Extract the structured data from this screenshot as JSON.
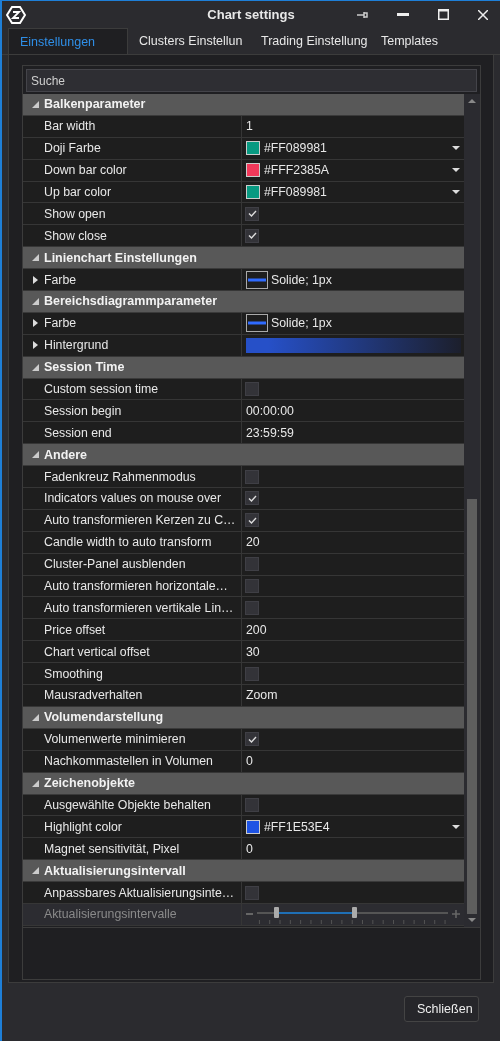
{
  "window": {
    "title": "Chart settings"
  },
  "tabs": [
    {
      "label": "Einstellungen",
      "selected": true
    },
    {
      "label": "Clusters Einstellun",
      "selected": false
    },
    {
      "label": "Trading Einstellung",
      "selected": false
    },
    {
      "label": "Templates",
      "selected": false
    }
  ],
  "search": {
    "placeholder": "Suche"
  },
  "sections": [
    {
      "title": "Balkenparameter",
      "expanded": true,
      "rows": [
        {
          "name": "Bar width",
          "kind": "text",
          "value": "1",
          "disabled": false
        },
        {
          "name": "Doji Farbe",
          "kind": "color",
          "value": "#FF089981",
          "color": "#089981",
          "disabled": false
        },
        {
          "name": "Down bar color",
          "kind": "color",
          "value": "#FFF2385A",
          "color": "#f2385a",
          "disabled": false
        },
        {
          "name": "Up bar color",
          "kind": "color",
          "value": "#FF089981",
          "color": "#089981",
          "disabled": false
        },
        {
          "name": "Show open",
          "kind": "check",
          "checked": true,
          "disabled": false
        },
        {
          "name": "Show close",
          "kind": "check",
          "checked": true,
          "disabled": false
        }
      ]
    },
    {
      "title": "Linienchart Einstellungen",
      "expanded": true,
      "rows": [
        {
          "name": "Farbe",
          "kind": "line",
          "value": "Solide; 1px",
          "color": "#2f6bff",
          "expanded": false,
          "disabled": false
        }
      ]
    },
    {
      "title": "Bereichsdiagrammparameter",
      "expanded": true,
      "rows": [
        {
          "name": "Farbe",
          "kind": "line",
          "value": "Solide; 1px",
          "color": "#2f6bff",
          "expanded": false,
          "disabled": false
        },
        {
          "name": "Hintergrund",
          "kind": "gradient",
          "color": "#2650c8",
          "expanded": false,
          "disabled": false
        }
      ]
    },
    {
      "title": "Session Time",
      "expanded": true,
      "rows": [
        {
          "name": "Custom session time",
          "kind": "check",
          "checked": false,
          "disabled": false
        },
        {
          "name": "Session begin",
          "kind": "text",
          "value": "00:00:00",
          "disabled": false
        },
        {
          "name": "Session end",
          "kind": "text",
          "value": "23:59:59",
          "disabled": false
        }
      ]
    },
    {
      "title": "Andere",
      "expanded": true,
      "rows": [
        {
          "name": "Fadenkreuz Rahmenmodus",
          "kind": "check",
          "checked": false,
          "disabled": false
        },
        {
          "name": "Indicators values on mouse over",
          "kind": "check",
          "checked": true,
          "disabled": false
        },
        {
          "name": "Auto transformieren Kerzen zu C…",
          "kind": "check",
          "checked": true,
          "disabled": false
        },
        {
          "name": "Candle width to auto transform",
          "kind": "text",
          "value": "20",
          "disabled": false
        },
        {
          "name": "Cluster-Panel ausblenden",
          "kind": "check",
          "checked": false,
          "disabled": false
        },
        {
          "name": "Auto transformieren horizontale…",
          "kind": "check",
          "checked": false,
          "disabled": false
        },
        {
          "name": "Auto transformieren vertikale Lin…",
          "kind": "check",
          "checked": false,
          "disabled": false
        },
        {
          "name": "Price offset",
          "kind": "text",
          "value": "200",
          "disabled": false
        },
        {
          "name": "Chart vertical offset",
          "kind": "text",
          "value": "30",
          "disabled": false
        },
        {
          "name": "Smoothing",
          "kind": "check",
          "checked": false,
          "disabled": false
        },
        {
          "name": "Mausradverhalten",
          "kind": "text",
          "value": "Zoom",
          "disabled": false
        }
      ]
    },
    {
      "title": "Volumendarstellung",
      "expanded": true,
      "rows": [
        {
          "name": "Volumenwerte minimieren",
          "kind": "check",
          "checked": true,
          "disabled": false
        },
        {
          "name": "Nachkommastellen in Volumen",
          "kind": "text",
          "value": "0",
          "disabled": false
        }
      ]
    },
    {
      "title": "Zeichenobjekte",
      "expanded": true,
      "rows": [
        {
          "name": "Ausgewählte Objekte behalten",
          "kind": "check",
          "checked": false,
          "disabled": false
        },
        {
          "name": "Highlight color",
          "kind": "color",
          "value": "#FF1E53E4",
          "color": "#1e53e4",
          "disabled": false
        },
        {
          "name": "Magnet sensitivität, Pixel",
          "kind": "text",
          "value": "0",
          "disabled": false
        }
      ]
    },
    {
      "title": "Aktualisierungsintervall",
      "expanded": true,
      "rows": [
        {
          "name": "Anpassbares Aktualisierungsinte…",
          "kind": "check",
          "checked": false,
          "disabled": false
        },
        {
          "name": "Aktualisierungsintervalle",
          "kind": "range",
          "thumbs": [
            {
              "level": 0.1
            },
            {
              "level": 0.51
            }
          ],
          "disabled": true
        }
      ]
    }
  ],
  "buttons": [
    {
      "label": "Schließen"
    }
  ]
}
